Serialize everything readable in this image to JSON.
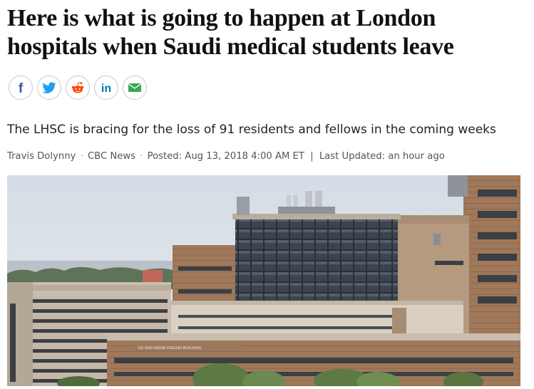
{
  "article": {
    "headline": "Here is what is going to happen at London hospitals when Saudi medical students leave",
    "deck": "The LHSC is bracing for the loss of 91 residents and fellows in the coming weeks",
    "byline": {
      "author": "Travis Dolynny",
      "outlet": "CBC News",
      "posted": "Posted: Aug 13, 2018 4:00 AM ET",
      "separator": "|",
      "updated": "Last Updated: an hour ago"
    },
    "photo": {
      "building_sign": "ED AND IRENE FREGIN BUILDING"
    }
  },
  "share": {
    "buttons": [
      {
        "icon": "facebook-icon",
        "color": "#3b5998"
      },
      {
        "icon": "twitter-icon",
        "color": "#1da1f2"
      },
      {
        "icon": "reddit-icon",
        "color": "#ff4500"
      },
      {
        "icon": "linkedin-icon",
        "color": "#0077b5"
      },
      {
        "icon": "email-icon",
        "color": "#3aa757"
      }
    ]
  }
}
